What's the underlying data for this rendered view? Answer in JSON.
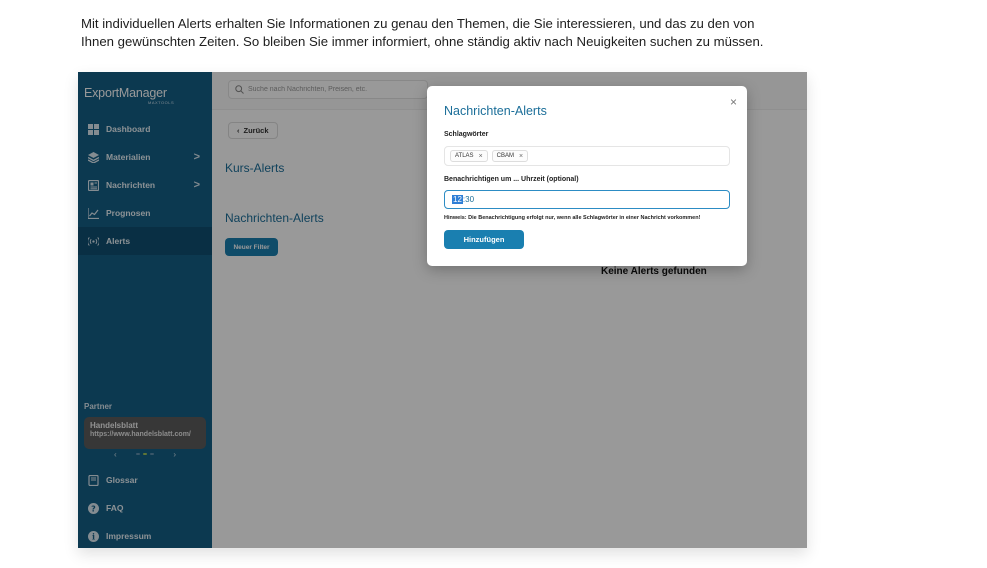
{
  "intro": {
    "line1": "Mit individuellen Alerts erhalten Sie Informationen zu genau den Themen, die Sie interessieren, und das zu den von",
    "line2": "Ihnen gewünschten Zeiten. So bleiben Sie immer informiert, ohne ständig aktiv nach Neuigkeiten suchen zu müssen."
  },
  "brand": {
    "name": "ExportManager",
    "sub": "MAXTOOLS"
  },
  "sidebar": {
    "items": [
      {
        "label": "Dashboard",
        "icon": "grid-icon"
      },
      {
        "label": "Materialien",
        "icon": "layers-icon",
        "chevron": ">"
      },
      {
        "label": "Nachrichten",
        "icon": "newspaper-icon",
        "chevron": ">"
      },
      {
        "label": "Prognosen",
        "icon": "chart-icon"
      },
      {
        "label": "Alerts",
        "icon": "broadcast-icon",
        "active": true
      }
    ],
    "collapse": "«",
    "partner_heading": "Partner",
    "partner": {
      "name": "Handelsblatt",
      "url": "https://www.handelsblatt.com/"
    },
    "carousel": {
      "prev": "‹",
      "next": "›"
    },
    "bottom_items": [
      {
        "label": "Glossar",
        "icon": "book-icon"
      },
      {
        "label": "FAQ",
        "icon": "help-icon"
      },
      {
        "label": "Impressum",
        "icon": "info-icon"
      }
    ]
  },
  "topbar": {
    "search_placeholder": "Suche nach Nachrichten, Preisen, etc."
  },
  "main": {
    "back_label": "Zurück",
    "back_icon": "‹",
    "course_alerts_title": "Kurs-Alerts",
    "news_alerts_title": "Nachrichten-Alerts",
    "new_filter_label": "Neuer Filter",
    "empty_text": "Keine Alerts gefunden"
  },
  "modal": {
    "title": "Nachrichten-Alerts",
    "close": "×",
    "keywords_label": "Schlagwörter",
    "tags": [
      "ATLAS",
      "CBAM"
    ],
    "tag_remove": "×",
    "time_label": "Benachrichtigen um ... Uhrzeit (optional)",
    "time_hour": "12",
    "time_rest": ":30",
    "hint": "Hinweis: Die Benachrichtigung erfolgt nur, wenn alle Schlagwörter in einer Nachricht vorkommen!",
    "submit_label": "Hinzufügen"
  },
  "colors": {
    "sidebar": "#145f86",
    "accent": "#1a7fb0",
    "title": "#1b6e99"
  }
}
